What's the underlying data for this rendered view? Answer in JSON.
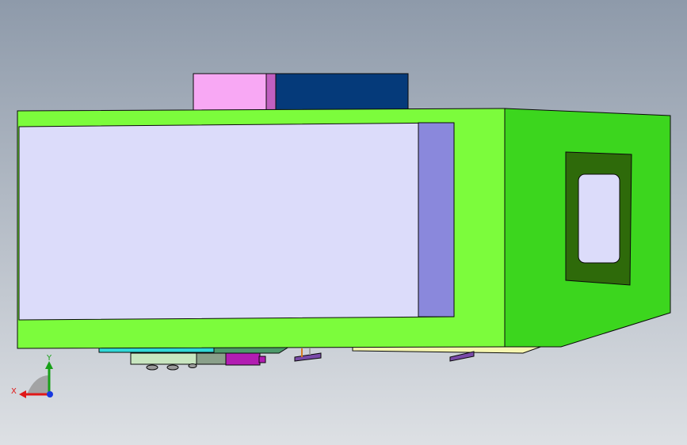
{
  "viewport": {
    "background_top": "#8e9aaa",
    "background_bottom": "#dde0e4"
  },
  "model": {
    "part_colors": {
      "frame_green": "#7cfc3c",
      "frame_outline": "#0a0a0a",
      "side_face": "#3cd61e",
      "window_opening": "#dcdcfa",
      "inner_side_panel": "#8a88dc",
      "side_cutout_frame": "#2e6a0a",
      "side_cutout_hole": "#dcdcfa",
      "top_pink_block": "#f8a8f4",
      "top_pink_edge": "#c060c0",
      "top_blue_block": "#053a7a",
      "bottom_cyan_strip": "#30d8d8",
      "bottom_teal_plate": "#4c9a6a",
      "bottom_magenta_part": "#b21cb2",
      "bottom_purple_feet": "#7a4aa8",
      "bottom_pale_plate": "#f6f6b0",
      "bottom_light_plate": "#c8e6c0"
    }
  },
  "triad": {
    "x_label": "X",
    "y_label": "Y",
    "x_color": "#e01818",
    "y_color": "#18a018",
    "z_color": "#1838e0",
    "plane_color": "#9a9a9a"
  }
}
